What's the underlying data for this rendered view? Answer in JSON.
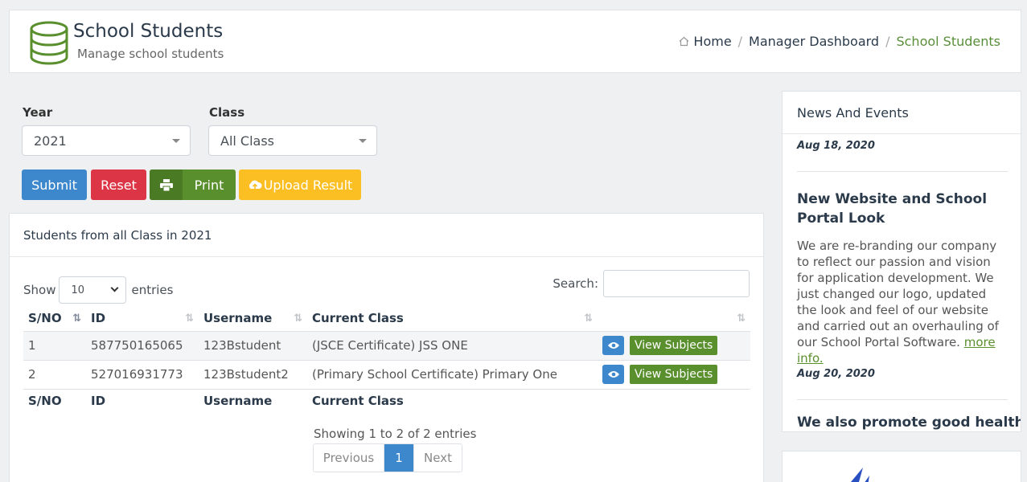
{
  "header": {
    "title": "School Students",
    "subtitle": "Manage school students",
    "breadcrumb": [
      "Home",
      "Manager Dashboard",
      "School Students"
    ]
  },
  "filters": {
    "year_label": "Year",
    "year_value": "2021",
    "class_label": "Class",
    "class_value": "All Class"
  },
  "buttons": {
    "submit": "Submit",
    "reset": "Reset",
    "print": "Print",
    "upload": "Upload Result"
  },
  "table_card": {
    "heading": "Students from all Class in 2021",
    "show_label": "Show",
    "entries_value": "10",
    "entries_label": "entries",
    "search_label": "Search:",
    "columns": [
      "S/NO",
      "ID",
      "Username",
      "Current Class"
    ],
    "rows": [
      {
        "sno": "1",
        "id": "587750165065",
        "username": "123Bstudent",
        "current_class": "(JSCE Certificate) JSS ONE"
      },
      {
        "sno": "2",
        "id": "527016931773",
        "username": "123Bstudent2",
        "current_class": "(Primary School Certificate) Primary One"
      }
    ],
    "view_subjects_label": "View Subjects",
    "info": "Showing 1 to 2 of 2 entries",
    "pagination": {
      "prev": "Previous",
      "current": "1",
      "next": "Next"
    }
  },
  "news": {
    "heading": "News And Events",
    "date1": "Aug 18, 2020",
    "item_title": "New Website and School Portal Look",
    "item_text": "We are re-branding our company to reflect our passion and vision for application development. We just changed our logo, updated the look and feel of our website and carried out an overhauling of our School Portal Software.",
    "more_link": "more info.",
    "date2": "Aug 20, 2020",
    "next_title": "We also promote good health"
  },
  "colors": {
    "primary": "#3d88cc",
    "danger": "#dc3545",
    "success": "#5a8f2e",
    "warning": "#fbbf24"
  }
}
